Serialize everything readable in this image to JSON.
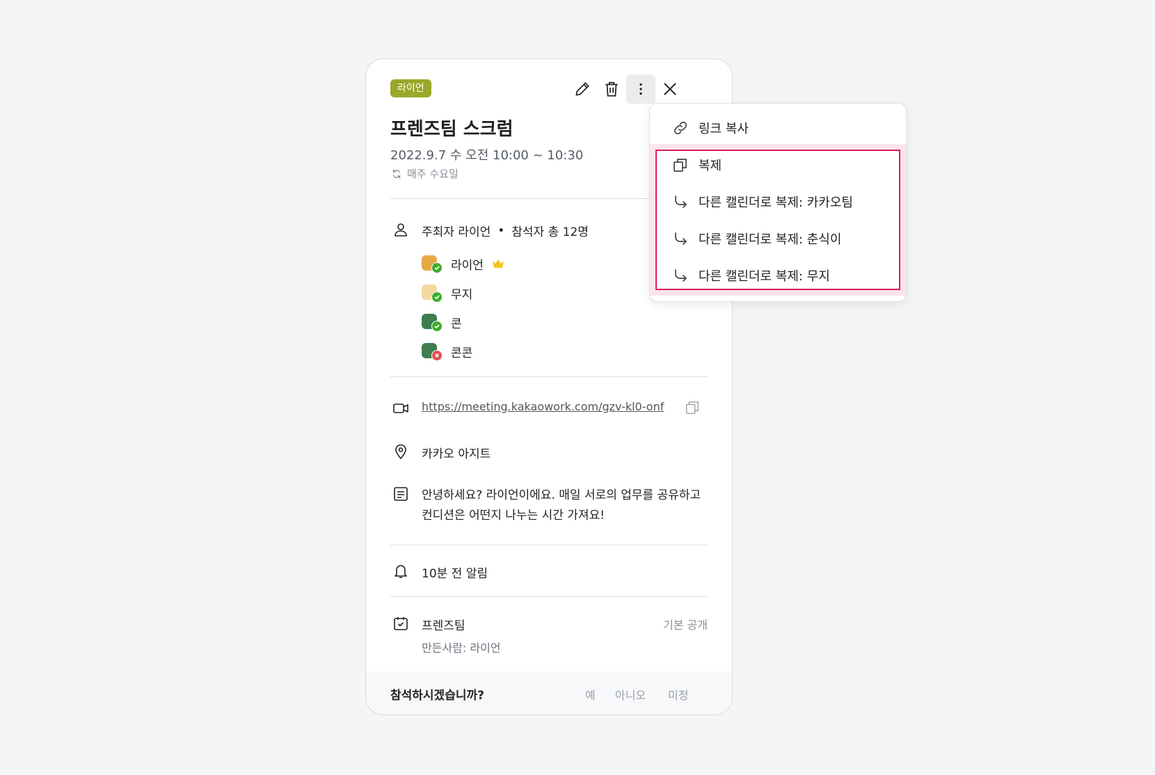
{
  "event": {
    "calendar_chip": "라이언",
    "title": "프렌즈팀 스크럼",
    "datetime": "2022.9.7 수 오전 10:00 ~ 10:30",
    "recurrence": "매주 수요일",
    "organizer_text": "주최자 라이언",
    "attendee_count_text": "참석자 총 12명",
    "attendees": [
      {
        "name": "라이언",
        "status": "accepted",
        "is_organizer": true
      },
      {
        "name": "무지",
        "status": "accepted"
      },
      {
        "name": "콘",
        "status": "accepted"
      },
      {
        "name": "콘콘",
        "status": "declined"
      }
    ],
    "meeting_link": "https://meeting.kakaowork.com/gzv-kl0-onf",
    "location": "카카오 아지트",
    "description": "안녕하세요? 라이언이에요. 매일 서로의 업무를 공유하고 컨디션은 어떤지 나누는 시간 가져요!",
    "alarm": "10분 전 알림",
    "calendar_name": "프렌즈팀",
    "visibility": "기본 공개",
    "creator": "만든사람: 라이언",
    "rsvp_question": "참석하시겠습니까?",
    "rsvp_options": [
      "예",
      "아니오",
      "미정"
    ]
  },
  "menu": {
    "items": [
      {
        "label": "링크 복사",
        "icon": "link-icon"
      },
      {
        "label": "복제",
        "icon": "duplicate-icon"
      },
      {
        "label": "다른 캘린더로 복제: 카카오팀",
        "icon": "arrow-turn-right-icon"
      },
      {
        "label": "다른 캘린더로 복제: 춘식이",
        "icon": "arrow-turn-right-icon"
      },
      {
        "label": "다른 캘린더로 복제: 무지",
        "icon": "arrow-turn-right-icon"
      }
    ]
  },
  "colors": {
    "chip": "#9aa82a",
    "highlight_frame": "#d81b60",
    "highlight_band": "#fce4ec",
    "accepted": "#3dae2b",
    "declined": "#e35454",
    "crown": "#f5c518"
  }
}
